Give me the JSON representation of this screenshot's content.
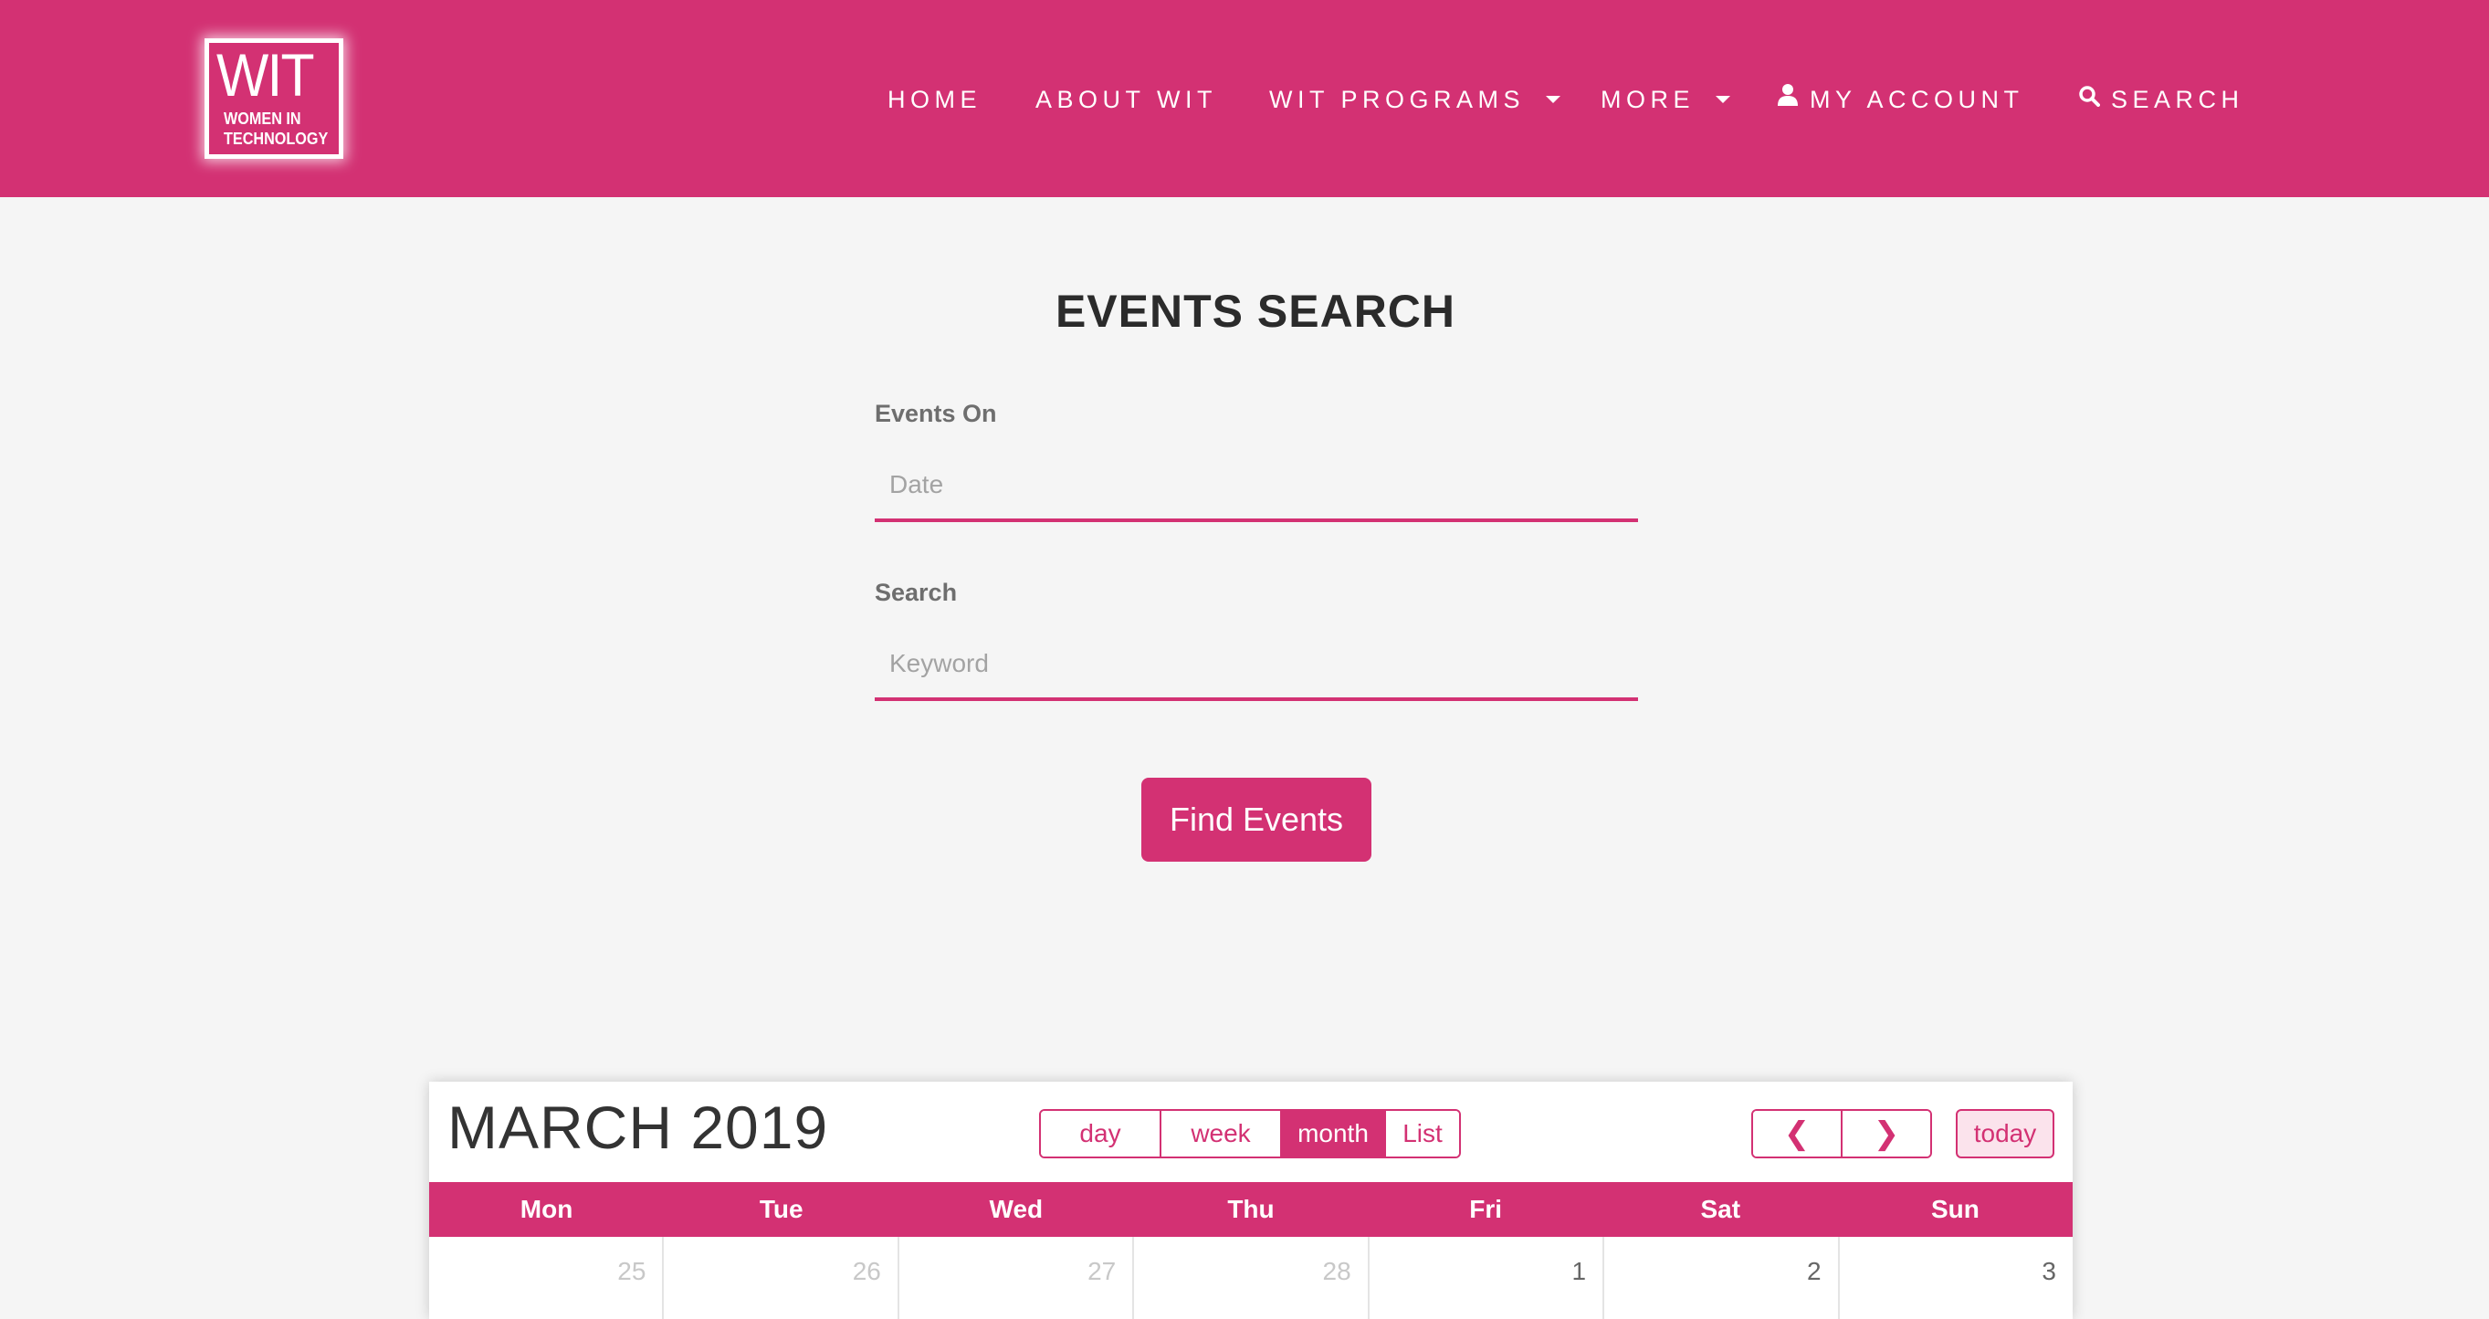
{
  "header": {
    "logo": {
      "big": "WIT",
      "line1": "WOMEN IN",
      "line2": "TECHNOLOGY"
    },
    "nav": [
      {
        "label": "HOME"
      },
      {
        "label": "ABOUT WIT"
      },
      {
        "label": "WIT PROGRAMS"
      },
      {
        "label": "MORE"
      },
      {
        "label": "MY ACCOUNT"
      },
      {
        "label": "SEARCH"
      }
    ]
  },
  "search": {
    "title": "EVENTS SEARCH",
    "events_on_label": "Events On",
    "date_placeholder": "Date",
    "search_label": "Search",
    "keyword_placeholder": "Keyword",
    "button_label": "Find Events"
  },
  "calendar": {
    "title": "MARCH 2019",
    "views": [
      "day",
      "week",
      "month",
      "List"
    ],
    "active_view": "month",
    "prev_glyph": "❮",
    "next_glyph": "❯",
    "today_label": "today",
    "weekdays": [
      "Mon",
      "Tue",
      "Wed",
      "Thu",
      "Fri",
      "Sat",
      "Sun"
    ],
    "first_week": [
      "25",
      "26",
      "27",
      "28",
      "1",
      "2",
      "3"
    ]
  },
  "colors": {
    "accent": "#d33173",
    "background": "#f5f5f5"
  },
  "icons": {
    "account": "user-icon",
    "search": "magnifier-icon",
    "dropdown": "caret-down-icon"
  }
}
